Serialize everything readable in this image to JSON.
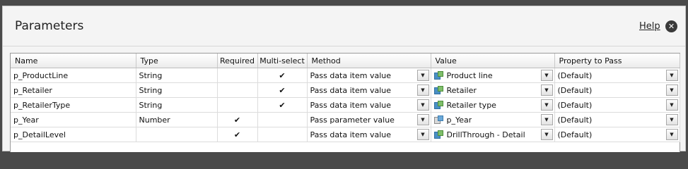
{
  "dialog": {
    "title": "Parameters",
    "help_label": "Help",
    "close_glyph": "✕"
  },
  "table": {
    "columns": [
      "Name",
      "Type",
      "Required",
      "Multi-select",
      "Method",
      "Value",
      "Property to Pass"
    ],
    "rows": [
      {
        "name": "p_ProductLine",
        "type": "String",
        "required": "",
        "multiselect": "✔",
        "method": "Pass data item value",
        "value": "Product line",
        "value_icon": "data-item-icon",
        "property": "(Default)"
      },
      {
        "name": "p_Retailer",
        "type": "String",
        "required": "",
        "multiselect": "✔",
        "method": "Pass data item value",
        "value": "Retailer",
        "value_icon": "data-item-icon",
        "property": "(Default)"
      },
      {
        "name": "p_RetailerType",
        "type": "String",
        "required": "",
        "multiselect": "✔",
        "method": "Pass data item value",
        "value": "Retailer type",
        "value_icon": "data-item-icon",
        "property": "(Default)"
      },
      {
        "name": "p_Year",
        "type": "Number",
        "required": "✔",
        "multiselect": "",
        "method": "Pass parameter value",
        "value": "p_Year",
        "value_icon": "parameter-icon",
        "property": "(Default)"
      },
      {
        "name": "p_DetailLevel",
        "type": "",
        "required": "✔",
        "multiselect": "",
        "method": "Pass data item value",
        "value": "DrillThrough - Detail",
        "value_icon": "data-item-icon",
        "property": "(Default)"
      }
    ],
    "dropdown_glyph": "▼"
  }
}
